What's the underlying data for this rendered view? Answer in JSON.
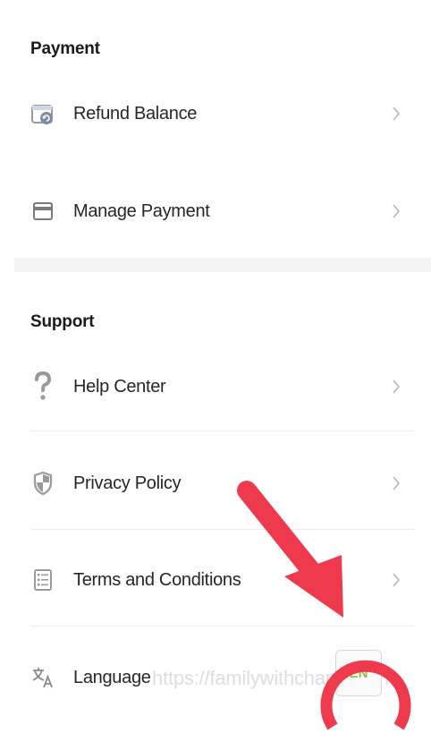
{
  "payment": {
    "title": "Payment",
    "items": [
      {
        "label": "Refund Balance",
        "icon": "refund-wallet-icon"
      },
      {
        "label": "Manage Payment",
        "icon": "card-icon"
      }
    ]
  },
  "support": {
    "title": "Support",
    "items": [
      {
        "label": "Help Center",
        "icon": "question-icon"
      },
      {
        "label": "Privacy Policy",
        "icon": "shield-icon"
      },
      {
        "label": "Terms and Conditions",
        "icon": "document-list-icon"
      },
      {
        "label": "Language",
        "icon": "translate-icon"
      }
    ]
  },
  "language": {
    "current": "EN"
  },
  "watermark": "https://familywithchang.com",
  "colors": {
    "annotation_red": "#ee3a4c",
    "badge_green": "#8bc34a",
    "chevron": "#b5b5b5",
    "icon": "#9a9a9a"
  }
}
